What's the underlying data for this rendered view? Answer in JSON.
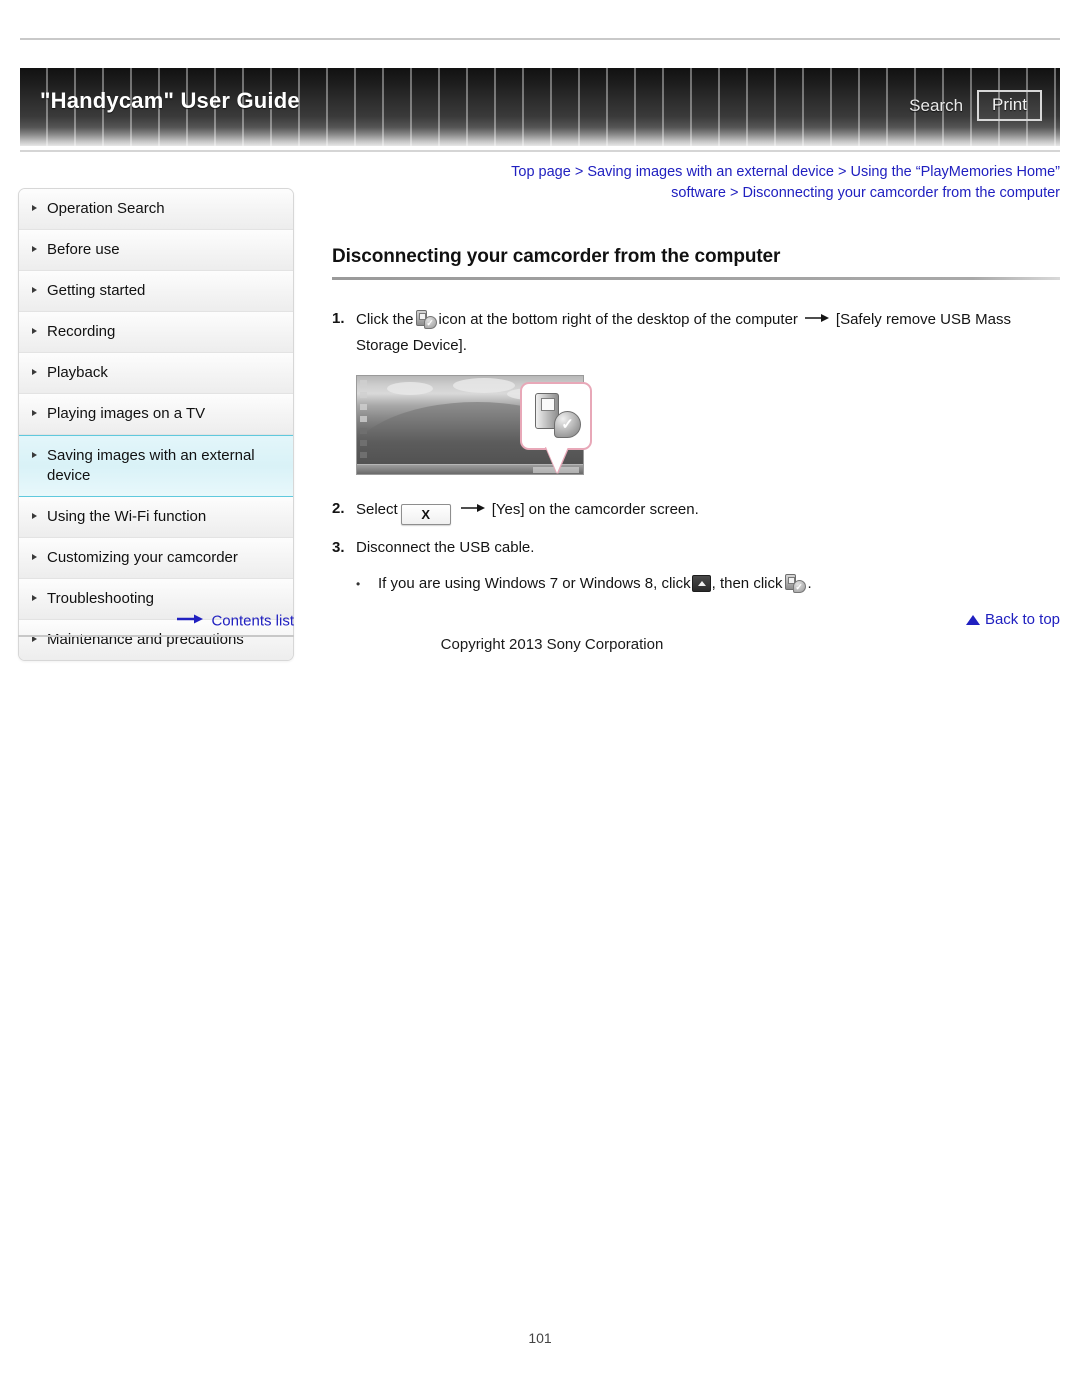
{
  "header": {
    "title": "\"Handycam\" User Guide",
    "search_label": "Search",
    "print_label": "Print"
  },
  "breadcrumb": {
    "line1": "Top page > Saving images with an external device > Using the “PlayMemories Home”",
    "line2": "software > Disconnecting your camcorder from the computer"
  },
  "sidebar": {
    "items": [
      {
        "label": "Operation Search",
        "active": false
      },
      {
        "label": "Before use",
        "active": false
      },
      {
        "label": "Getting started",
        "active": false
      },
      {
        "label": "Recording",
        "active": false
      },
      {
        "label": "Playback",
        "active": false
      },
      {
        "label": "Playing images on a TV",
        "active": false
      },
      {
        "label": "Saving images with an external device",
        "active": true
      },
      {
        "label": "Using the Wi-Fi function",
        "active": false
      },
      {
        "label": "Customizing your camcorder",
        "active": false
      },
      {
        "label": "Troubleshooting",
        "active": false
      },
      {
        "label": "Maintenance and precautions",
        "active": false
      }
    ],
    "contents_list_label": "Contents list"
  },
  "main": {
    "page_title": "Disconnecting your camcorder from the computer",
    "steps": [
      {
        "num": "1.",
        "text_before": "Click the",
        "icon": "usb-safely-remove-icon",
        "text_mid": "icon at the bottom right of the desktop of the computer",
        "arrow": "→",
        "text_after": "[Safely remove USB Mass Storage Device]."
      },
      {
        "num": "2.",
        "text_before": "Select",
        "icon": "x-button-icon",
        "icon_label": "X",
        "arrow": "→",
        "text_after": "[Yes] on the camcorder screen."
      },
      {
        "num": "3.",
        "text_before": "Disconnect the USB cable."
      }
    ],
    "note": {
      "bullet": "•",
      "text_before": "If you are using Windows 7 or Windows 8, click",
      "icon1": "show-hidden-icons-tray-icon",
      "text_mid": ", then click",
      "icon2": "usb-safely-remove-icon",
      "text_after": "."
    },
    "figure": {
      "name": "desktop-screenshot-with-usb-callout",
      "callout_icon": "usb-safely-remove-large-icon",
      "check_glyph": "✓"
    },
    "back_to_top_label": "Back to top"
  },
  "footer": {
    "copyright": "Copyright 2013 Sony Corporation",
    "page_number": "101"
  },
  "colors": {
    "link": "#2020c0",
    "active_nav_border": "#5fc9dd",
    "callout_border": "#e8a8b8"
  }
}
